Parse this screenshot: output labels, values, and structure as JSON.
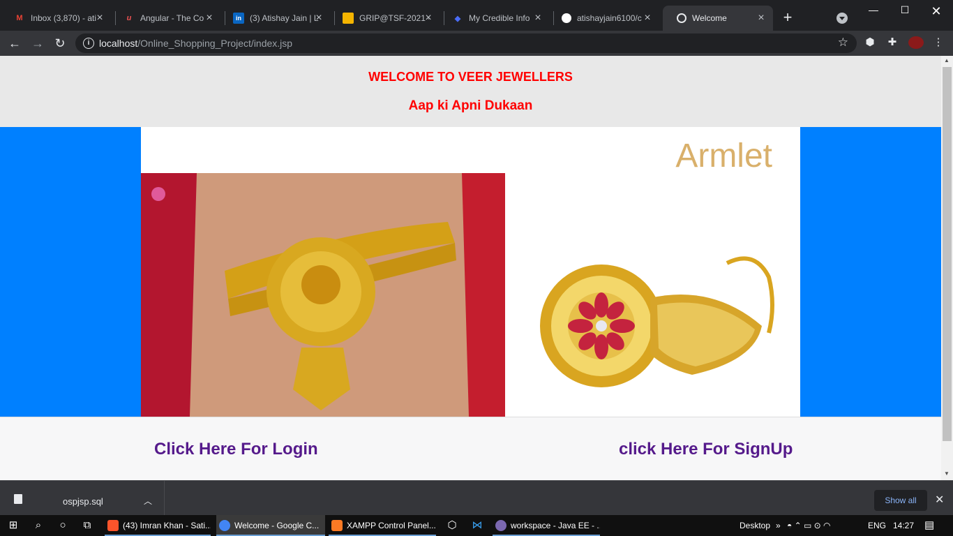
{
  "tabs": [
    {
      "title": "Inbox (3,870) - ati",
      "favicon": "gmail-icon",
      "color": "#ea4335",
      "glyph": "M"
    },
    {
      "title": "Angular - The Co",
      "favicon": "udemy-icon",
      "color": "#ec5252",
      "glyph": "u"
    },
    {
      "title": "(3) Atishay Jain | L",
      "favicon": "linkedin-icon",
      "color": "#0a66c2",
      "glyph": "in"
    },
    {
      "title": "GRIP@TSF-2021 -",
      "favicon": "slides-icon",
      "color": "#f4b400",
      "glyph": "▬"
    },
    {
      "title": "My Credible Info",
      "favicon": "page-icon",
      "color": "#4a6cf7",
      "glyph": "◆"
    },
    {
      "title": "atishayjain6100/c",
      "favicon": "github-icon",
      "color": "#ffffff",
      "glyph": "●"
    },
    {
      "title": "Welcome",
      "favicon": "globe-icon",
      "color": "#e8eaed",
      "glyph": "◍",
      "active": true
    }
  ],
  "address": {
    "host": "localhost",
    "path": "/Online_Shopping_Project/index.jsp"
  },
  "page": {
    "heading": "WELCOME TO VEER JEWELLERS",
    "subheading": "Aap ki Apni Dukaan",
    "banner_label": "Armlet",
    "login_link": "Click Here For Login",
    "signup_link": "click Here For SignUp"
  },
  "downloads": {
    "file": "ospjsp.sql",
    "show_all": "Show all"
  },
  "taskbar": {
    "apps": [
      {
        "label": "(43) Imran Khan - Sati...",
        "color": "#fb542b"
      },
      {
        "label": "Welcome - Google C...",
        "color": "#4285f4",
        "active": true
      },
      {
        "label": "XAMPP Control Panel...",
        "color": "#fb7a24"
      },
      {
        "label": "workspace - Java EE - ...",
        "color": "#7b68b0"
      }
    ],
    "desktop": "Desktop",
    "lang": "ENG",
    "time": "14:27"
  },
  "colors": {
    "heading": "#ff0000",
    "banner_bg": "#0080ff",
    "link": "#551a8b"
  }
}
